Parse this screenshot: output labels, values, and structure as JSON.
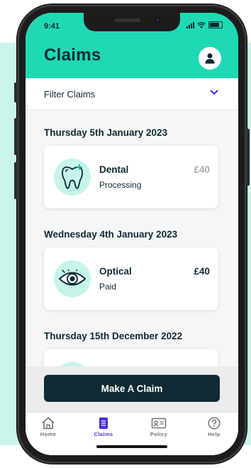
{
  "status_bar": {
    "time": "9:41"
  },
  "header": {
    "title": "Claims"
  },
  "filter": {
    "label": "Filter Claims"
  },
  "claim_groups": [
    {
      "date": "Thursday 5th January 2023",
      "claim": {
        "type": "Dental",
        "status": "Processing",
        "amount": "£40",
        "amount_color": "#a3abaf",
        "icon": "tooth-icon"
      }
    },
    {
      "date": "Wednesday 4th January 2023",
      "claim": {
        "type": "Optical",
        "status": "Paid",
        "amount": "£40",
        "amount_color": "#0f2a33",
        "icon": "eye-icon"
      }
    },
    {
      "date": "Thursday 15th December 2022"
    }
  ],
  "cta": {
    "label": "Make A Claim"
  },
  "tabs": [
    {
      "label": "Home",
      "icon": "home-icon",
      "active": false
    },
    {
      "label": "Claims",
      "icon": "claims-icon",
      "active": true
    },
    {
      "label": "Policy",
      "icon": "policy-card-icon",
      "active": false
    },
    {
      "label": "Help",
      "icon": "help-icon",
      "active": false
    }
  ],
  "colors": {
    "accent": "#1ed9b4",
    "primary_dark": "#0f2a33",
    "active_tab": "#4a2de0",
    "mint_background": "#c9f5ec"
  }
}
